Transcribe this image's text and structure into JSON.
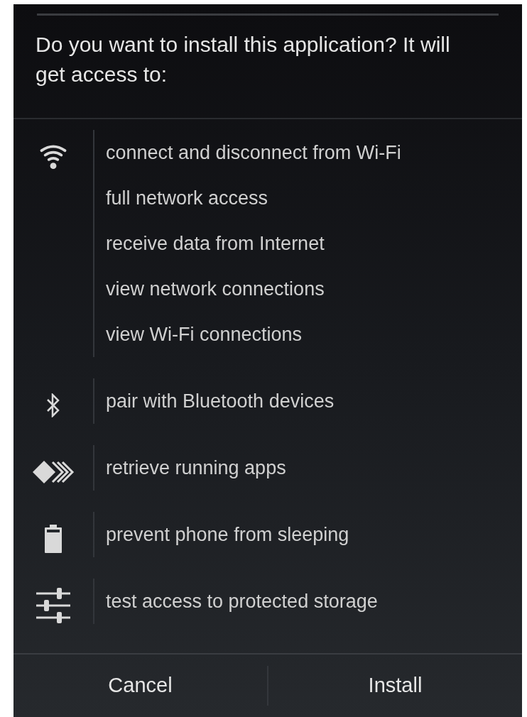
{
  "dialog": {
    "title": "Do you want to install this application? It will get access to:",
    "groups": [
      {
        "kind": "wifi",
        "permissions": [
          "connect and disconnect from Wi-Fi",
          "full network access",
          "receive data from Internet",
          "view network connections",
          "view Wi-Fi connections"
        ]
      },
      {
        "kind": "bluetooth",
        "permissions": [
          "pair with Bluetooth devices"
        ]
      },
      {
        "kind": "apps",
        "permissions": [
          "retrieve running apps"
        ]
      },
      {
        "kind": "battery",
        "permissions": [
          "prevent phone from sleeping"
        ]
      },
      {
        "kind": "storage",
        "permissions": [
          "test access to protected storage"
        ]
      }
    ],
    "buttons": [
      "Cancel",
      "Install"
    ]
  }
}
